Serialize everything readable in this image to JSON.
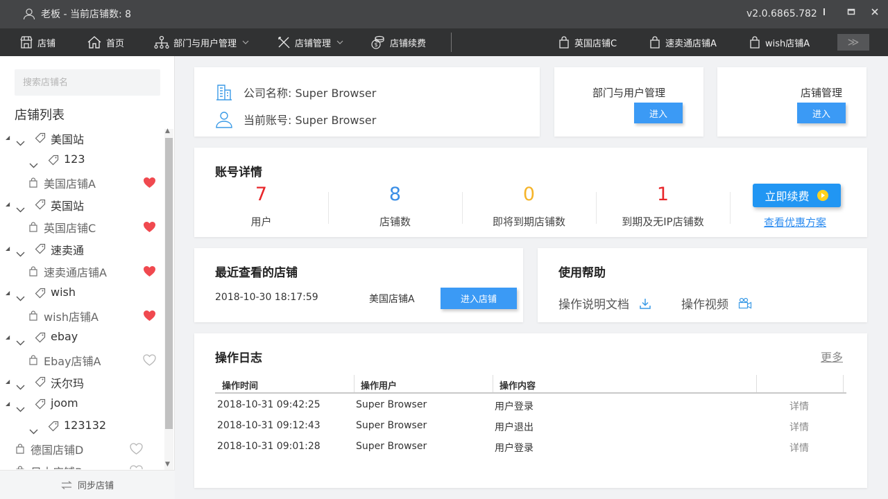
{
  "titlebar": {
    "user_text": "老板 - 当前店铺数: 8",
    "version": "v2.0.6865.782",
    "min": "─",
    "max": "▭",
    "close": "✕"
  },
  "nav": {
    "shops": "店铺",
    "home": "首页",
    "dept": "部门与用户管理",
    "shop_mgmt": "店铺管理",
    "renew": "店铺续费",
    "tab1": "英国店铺C",
    "tab2": "速卖通店铺A",
    "tab3": "wish店铺A",
    "more": "≫"
  },
  "sidebar": {
    "search_placeholder": "搜索店铺名",
    "title": "店铺列表",
    "sync": "同步店铺",
    "items": [
      {
        "label": "美国站"
      },
      {
        "label": "123"
      },
      {
        "label": "美国店铺A"
      },
      {
        "label": "英国站"
      },
      {
        "label": "英国店铺C"
      },
      {
        "label": "速卖通"
      },
      {
        "label": "速卖通店铺A"
      },
      {
        "label": "wish"
      },
      {
        "label": "wish店铺A"
      },
      {
        "label": "ebay"
      },
      {
        "label": "Ebay店铺A"
      },
      {
        "label": "沃尔玛"
      },
      {
        "label": "joom"
      },
      {
        "label": "123132"
      },
      {
        "label": "德国店铺D"
      },
      {
        "label": "日本店铺B"
      }
    ]
  },
  "company": {
    "name": "公司名称: Super Browser",
    "account": "当前账号: Super Browser"
  },
  "dept_card": {
    "title": "部门与用户管理",
    "button": "进入"
  },
  "shop_card": {
    "title": "店铺管理",
    "button": "进入"
  },
  "account": {
    "title": "账号详情",
    "stats": [
      {
        "value": "7",
        "label": "用户"
      },
      {
        "value": "8",
        "label": "店铺数"
      },
      {
        "value": "0",
        "label": "即将到期店铺数"
      },
      {
        "value": "1",
        "label": "到期及无IP店铺数"
      }
    ],
    "renew_button": "立即续费",
    "offer_link": "查看优惠方案"
  },
  "recent": {
    "title": "最近查看的店铺",
    "time": "2018-10-30 18:17:59",
    "shop": "美国店铺A",
    "button": "进入店铺"
  },
  "help": {
    "title": "使用帮助",
    "doc": "操作说明文档",
    "video": "操作视频"
  },
  "log": {
    "title": "操作日志",
    "more": "更多",
    "headers": [
      "操作时间",
      "操作用户",
      "操作内容"
    ],
    "rows": [
      {
        "time": "2018-10-31 09:42:25",
        "user": "Super Browser",
        "content": "用户登录",
        "detail": "详情"
      },
      {
        "time": "2018-10-31 09:12:43",
        "user": "Super Browser",
        "content": "用户退出",
        "detail": "详情"
      },
      {
        "time": "2018-10-31 09:01:28",
        "user": "Super Browser",
        "content": "用户登录",
        "detail": "详情"
      }
    ]
  },
  "colors": {
    "red": "#e8262a",
    "blue": "#3a8ee6",
    "orange": "#f5b42a",
    "heart": "#f0494f"
  }
}
